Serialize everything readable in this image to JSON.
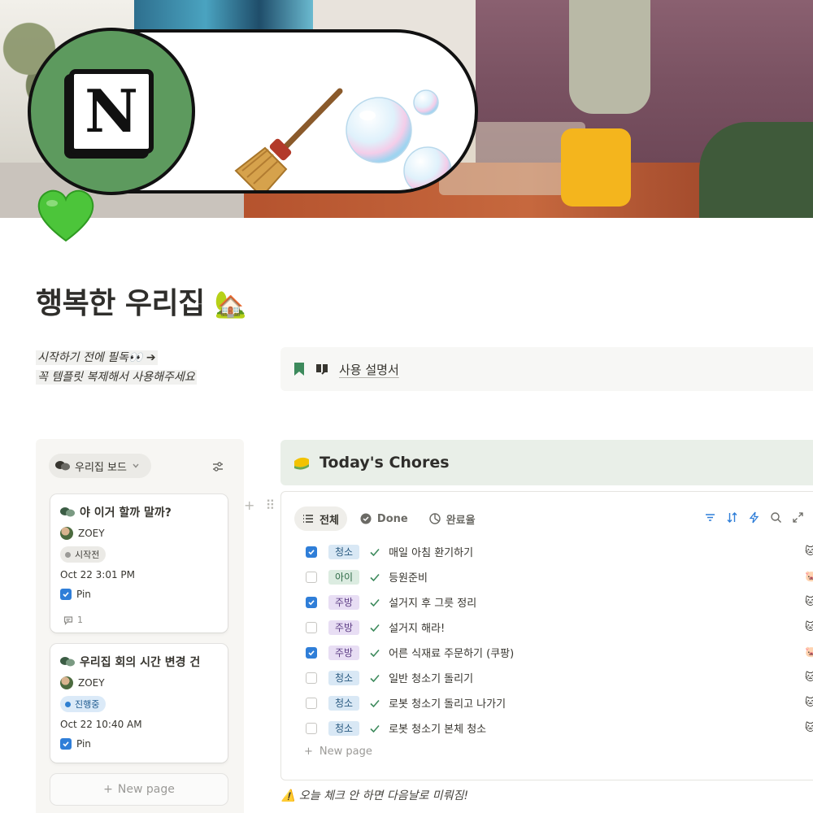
{
  "banner": {
    "logo_letter": "N"
  },
  "page": {
    "title": "행복한 우리집",
    "title_emoji": "🏡",
    "icon_emoji": "💚"
  },
  "intro": {
    "line1": "시작하기 전에 필독👀 ➔",
    "line2": "꼭 템플릿 복제해서 사용해주세요"
  },
  "guide": {
    "label": "사용 설명서"
  },
  "board": {
    "title": "우리집 보드",
    "cards": [
      {
        "title": "야 이거 할까 말까?",
        "user": "ZOEY",
        "status": "시작전",
        "date": "Oct 22 3:01 PM",
        "pin_label": "Pin",
        "comments": "1"
      },
      {
        "title": "우리집 회의 시간 변경 건",
        "user": "ZOEY",
        "status": "진행중",
        "date": "Oct 22 10:40 AM",
        "pin_label": "Pin"
      }
    ],
    "new_label": "New page"
  },
  "chores": {
    "title": "Today's Chores",
    "tabs": [
      {
        "label": "전체",
        "active": true
      },
      {
        "label": "Done",
        "active": false
      },
      {
        "label": "완료율",
        "active": false
      }
    ],
    "rows": [
      {
        "checked": true,
        "tag": "청소",
        "task": "매일 아침 환기하기",
        "who": "🐱"
      },
      {
        "checked": false,
        "tag": "아이",
        "task": "등원준비",
        "who": "🐷"
      },
      {
        "checked": true,
        "tag": "주방",
        "task": "설거지 후 그릇 정리",
        "who": "🐱"
      },
      {
        "checked": false,
        "tag": "주방",
        "task": "설거지 해라!",
        "who": "🐱"
      },
      {
        "checked": true,
        "tag": "주방",
        "task": "어른 식재료 주문하기 (쿠팡)",
        "who": "🐷"
      },
      {
        "checked": false,
        "tag": "청소",
        "task": "일반 청소기 돌리기",
        "who": "🐱"
      },
      {
        "checked": false,
        "tag": "청소",
        "task": "로봇 청소기 돌리고 나가기",
        "who": "🐱"
      },
      {
        "checked": false,
        "tag": "청소",
        "task": "로봇 청소기 본체 청소",
        "who": "🐱"
      }
    ],
    "new_label": "New page",
    "tag_colors": {
      "청소": "blue",
      "아이": "green",
      "주방": "purple"
    }
  },
  "note": "⚠️ 오늘 체크 안 하면 다음날로 미뤄짐!",
  "colors": {
    "accent_blue": "#2f7ed8",
    "check_green": "#3d8a5c",
    "logo_green": "#5d9a5e"
  }
}
